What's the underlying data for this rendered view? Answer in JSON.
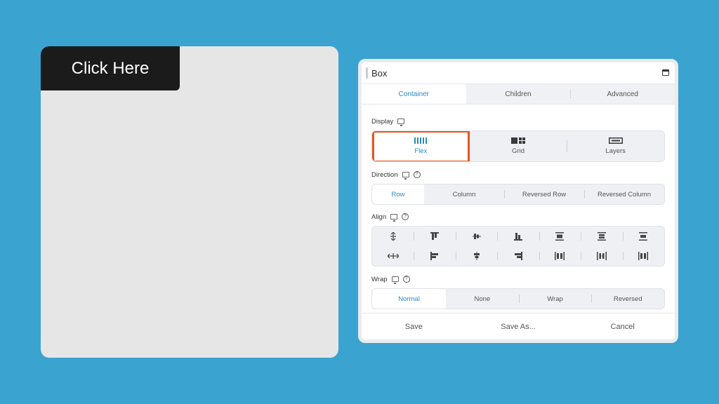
{
  "canvas": {
    "button_label": "Click Here"
  },
  "panel": {
    "title": "Box",
    "tabs": [
      {
        "label": "Container",
        "active": true
      },
      {
        "label": "Children",
        "active": false
      },
      {
        "label": "Advanced",
        "active": false
      }
    ],
    "display": {
      "label": "Display",
      "options": [
        {
          "label": "Flex",
          "icon": "flex-columns-icon",
          "active": true
        },
        {
          "label": "Grid",
          "icon": "grid-icon",
          "active": false
        },
        {
          "label": "Layers",
          "icon": "layers-icon",
          "active": false
        }
      ]
    },
    "direction": {
      "label": "Direction",
      "options": [
        "Row",
        "Column",
        "Reversed Row",
        "Reversed Column"
      ]
    },
    "align": {
      "label": "Align"
    },
    "wrap": {
      "label": "Wrap",
      "options": [
        "Normal",
        "None",
        "Wrap",
        "Reversed"
      ]
    },
    "footer": {
      "save": "Save",
      "save_as": "Save As...",
      "cancel": "Cancel"
    }
  },
  "colors": {
    "accent": "#2a8bc2",
    "highlight": "#e4561f",
    "background": "#3ba3d0"
  }
}
